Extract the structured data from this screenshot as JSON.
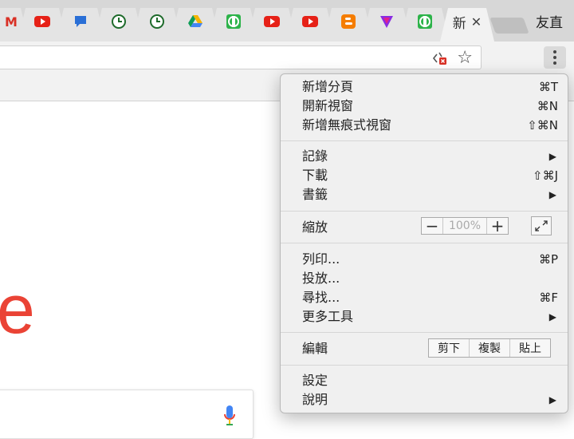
{
  "tabs": [
    {
      "favicon": "gmail-icon",
      "glyph": "M"
    },
    {
      "favicon": "youtube-icon"
    },
    {
      "favicon": "chat-bubble-icon"
    },
    {
      "favicon": "clock-icon"
    },
    {
      "favicon": "clock-icon"
    },
    {
      "favicon": "google-drive-icon"
    },
    {
      "favicon": "green-face-icon"
    },
    {
      "favicon": "youtube-icon"
    },
    {
      "favicon": "youtube-icon"
    },
    {
      "favicon": "blogger-icon"
    },
    {
      "favicon": "triangle-v-icon"
    },
    {
      "favicon": "green-face-icon"
    },
    {
      "favicon": "active-tab",
      "label": "新",
      "close": "✕"
    }
  ],
  "profile": {
    "name": "友直"
  },
  "toolbar": {
    "blocked_icon": "popup-blocked-icon",
    "star": "☆",
    "menu_icon": "more-vertical-icon"
  },
  "page": {
    "logo_letter": "e"
  },
  "menu": {
    "group1": [
      {
        "label": "新增分頁",
        "shortcut": "⌘T"
      },
      {
        "label": "開新視窗",
        "shortcut": "⌘N"
      },
      {
        "label": "新增無痕式視窗",
        "shortcut": "⇧⌘N"
      }
    ],
    "group2": [
      {
        "label": "記錄",
        "arrow": "▶"
      },
      {
        "label": "下載",
        "shortcut": "⇧⌘J"
      },
      {
        "label": "書籤",
        "arrow": "▶"
      }
    ],
    "zoom": {
      "label": "縮放",
      "minus": "−",
      "value": "100%",
      "plus": "+"
    },
    "group3": [
      {
        "label": "列印...",
        "shortcut": "⌘P"
      },
      {
        "label": "投放..."
      },
      {
        "label": "尋找...",
        "shortcut": "⌘F"
      },
      {
        "label": "更多工具",
        "arrow": "▶"
      }
    ],
    "edit": {
      "label": "編輯",
      "cut": "剪下",
      "copy": "複製",
      "paste": "貼上"
    },
    "group4": [
      {
        "label": "設定"
      },
      {
        "label": "說明",
        "arrow": "▶"
      }
    ]
  }
}
